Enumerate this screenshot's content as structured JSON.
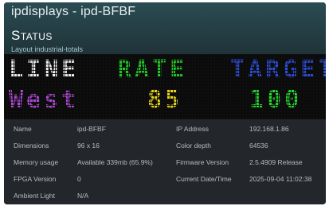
{
  "header": {
    "app_title": "ipdisplays - ipd-BFBF",
    "section_title": "Status",
    "layout_label": "Layout industrial-totals"
  },
  "display": {
    "row1": [
      {
        "text": "LINE",
        "color": "#f2f2f2"
      },
      {
        "text": "RATE",
        "color": "#22c427"
      },
      {
        "text": "TARGET",
        "color": "#2d4fd9"
      }
    ],
    "row2": [
      {
        "text": "West",
        "color": "#b04ad6"
      },
      {
        "text": "85",
        "color": "#e6d21c"
      },
      {
        "text": "100",
        "color": "#28d630"
      }
    ]
  },
  "info": {
    "rows": [
      {
        "k1": "Name",
        "v1": "ipd-BFBF",
        "k2": "IP Address",
        "v2": "192.168.1.86"
      },
      {
        "k1": "Dimensions",
        "v1": "96 x 16",
        "k2": "Color depth",
        "v2": "64536"
      },
      {
        "k1": "Memory usage",
        "v1": "Available 339mb (65.9%)",
        "k2": "Firmware Version",
        "v2": "2.5.4909 Release"
      },
      {
        "k1": "FPGA Version",
        "v1": "0",
        "k2": "Current Date/Time",
        "v2": "2025-09-04 11:02:38"
      },
      {
        "k1": "Ambient Light",
        "v1": "N/A",
        "k2": "",
        "v2": ""
      }
    ]
  }
}
